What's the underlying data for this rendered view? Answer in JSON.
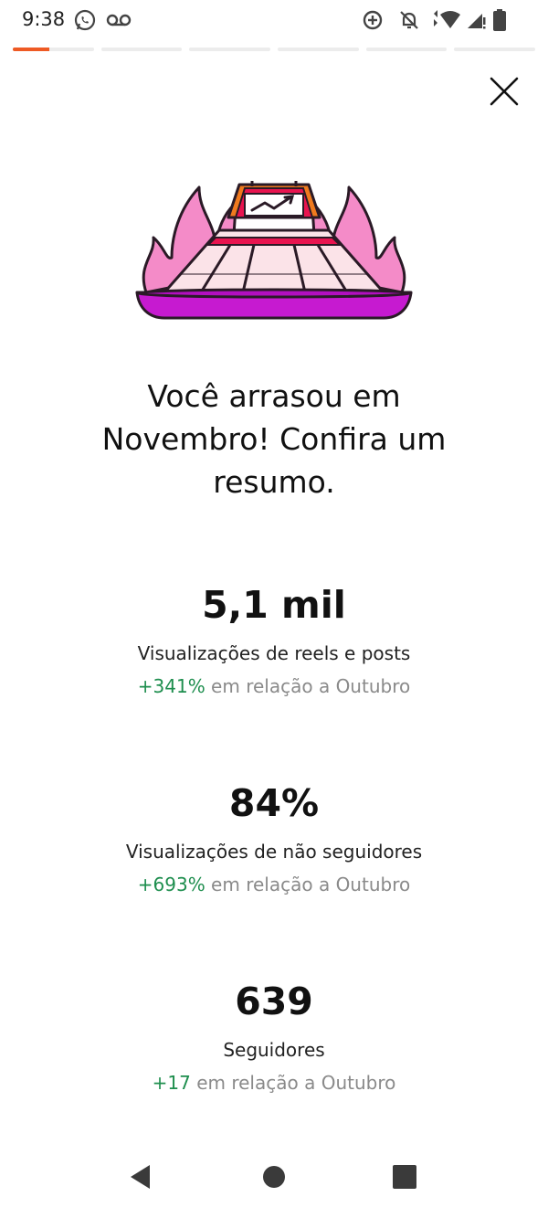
{
  "status_bar": {
    "time": "9:38",
    "icons": [
      "whatsapp-icon",
      "voicemail-icon",
      "data-saver-icon",
      "bell-off-icon",
      "wifi-icon",
      "signal-icon",
      "battery-icon"
    ]
  },
  "progress": {
    "segments": 6,
    "current_index": 0,
    "current_fill": 0.45,
    "active_color": "#ee5a24"
  },
  "close": {
    "icon": "close-icon"
  },
  "hero": {
    "illustration": "stadium-fire-chart-illustration"
  },
  "headline": "Você arrasou em Novembro! Confira um resumo.",
  "stats": [
    {
      "value": "5,1 mil",
      "label": "Visualizações de reels e posts",
      "delta": "+341%",
      "comparison": " em relação a Outubro"
    },
    {
      "value": "84%",
      "label": "Visualizações de não seguidores",
      "delta": "+693%",
      "comparison": " em relação a Outubro"
    },
    {
      "value": "639",
      "label": "Seguidores",
      "delta": "+17",
      "comparison": " em relação a Outubro"
    }
  ],
  "colors": {
    "positive": "#1e8e4e",
    "muted": "#8a8a8a",
    "flame": "#f48bc8",
    "base": "#c61ad0",
    "accent_red": "#e8144f",
    "accent_orange": "#f07a1e"
  },
  "nav_bar": {
    "back_icon": "back-triangle-icon",
    "home_icon": "home-circle-icon",
    "recents_icon": "recents-square-icon"
  }
}
